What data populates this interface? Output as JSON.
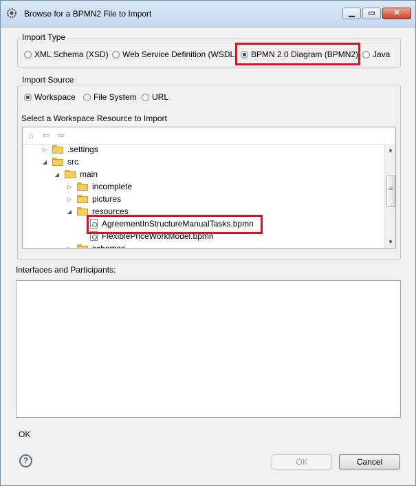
{
  "window": {
    "title": "Browse for a BPMN2 File to Import"
  },
  "import_type": {
    "label": "Import Type",
    "options": [
      {
        "label": "XML Schema (XSD)",
        "checked": false
      },
      {
        "label": "Web Service Definition (WSDL)",
        "checked": false
      },
      {
        "label": "BPMN 2.0 Diagram (BPMN2)",
        "checked": true
      },
      {
        "label": "Java",
        "checked": false
      }
    ]
  },
  "import_source": {
    "label": "Import Source",
    "options": [
      {
        "label": "Workspace",
        "checked": true
      },
      {
        "label": "File System",
        "checked": false
      },
      {
        "label": "URL",
        "checked": false
      }
    ]
  },
  "resource": {
    "label": "Select a Workspace Resource to Import",
    "tree": [
      {
        "label": ".settings",
        "type": "folder",
        "state": "collapsed"
      },
      {
        "label": "src",
        "type": "folder",
        "state": "expanded"
      },
      {
        "label": "main",
        "type": "folder",
        "state": "expanded"
      },
      {
        "label": "incomplete",
        "type": "folder",
        "state": "collapsed"
      },
      {
        "label": "pictures",
        "type": "folder",
        "state": "collapsed"
      },
      {
        "label": "resources",
        "type": "folder",
        "state": "expanded"
      },
      {
        "label": "AgreementInStructureManualTasks.bpmn",
        "type": "file",
        "selected": true
      },
      {
        "label": "FlexiblePriceWorkModel.bpmn",
        "type": "file"
      },
      {
        "label": "schemas",
        "type": "folder",
        "state": "collapsed"
      }
    ]
  },
  "interfaces": {
    "label": "Interfaces and Participants:"
  },
  "status": {
    "message": "OK"
  },
  "buttons": {
    "ok": "OK",
    "cancel": "Cancel"
  },
  "colors": {
    "highlight": "#e0101c"
  }
}
